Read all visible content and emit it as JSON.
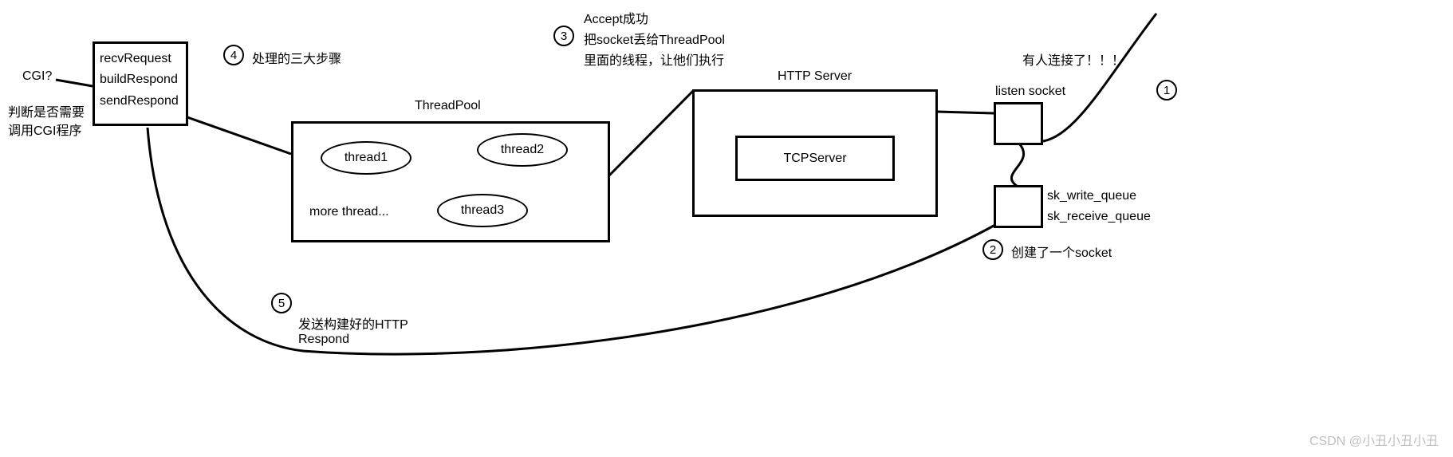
{
  "handlerBox": {
    "line1": "recvRequest",
    "line2": "buildRespond",
    "line3": "sendRespond"
  },
  "cgi": {
    "question": "CGI?",
    "desc1": "判断是否需要",
    "desc2": "调用CGI程序"
  },
  "threadPool": {
    "title": "ThreadPool",
    "thread1": "thread1",
    "thread2": "thread2",
    "thread3": "thread3",
    "more": "more thread..."
  },
  "httpServer": {
    "title": "HTTP Server",
    "inner": "TCPServer"
  },
  "listenSocket": {
    "label": "listen socket"
  },
  "connMsg": "有人连接了！！！",
  "queueBox": {
    "q1": "sk_write_queue",
    "q2": "sk_receive_queue"
  },
  "steps": {
    "s1": {
      "num": "1"
    },
    "s2": {
      "num": "2",
      "text": "创建了一个socket"
    },
    "s3": {
      "num": "3",
      "l1": "Accept成功",
      "l2": "把socket丢给ThreadPool",
      "l3": "里面的线程，让他们执行"
    },
    "s4": {
      "num": "4",
      "text": "处理的三大步骤"
    },
    "s5": {
      "num": "5",
      "l1": "发送构建好的HTTP",
      "l2": "Respond"
    }
  },
  "watermark": "CSDN @小丑小丑小丑"
}
